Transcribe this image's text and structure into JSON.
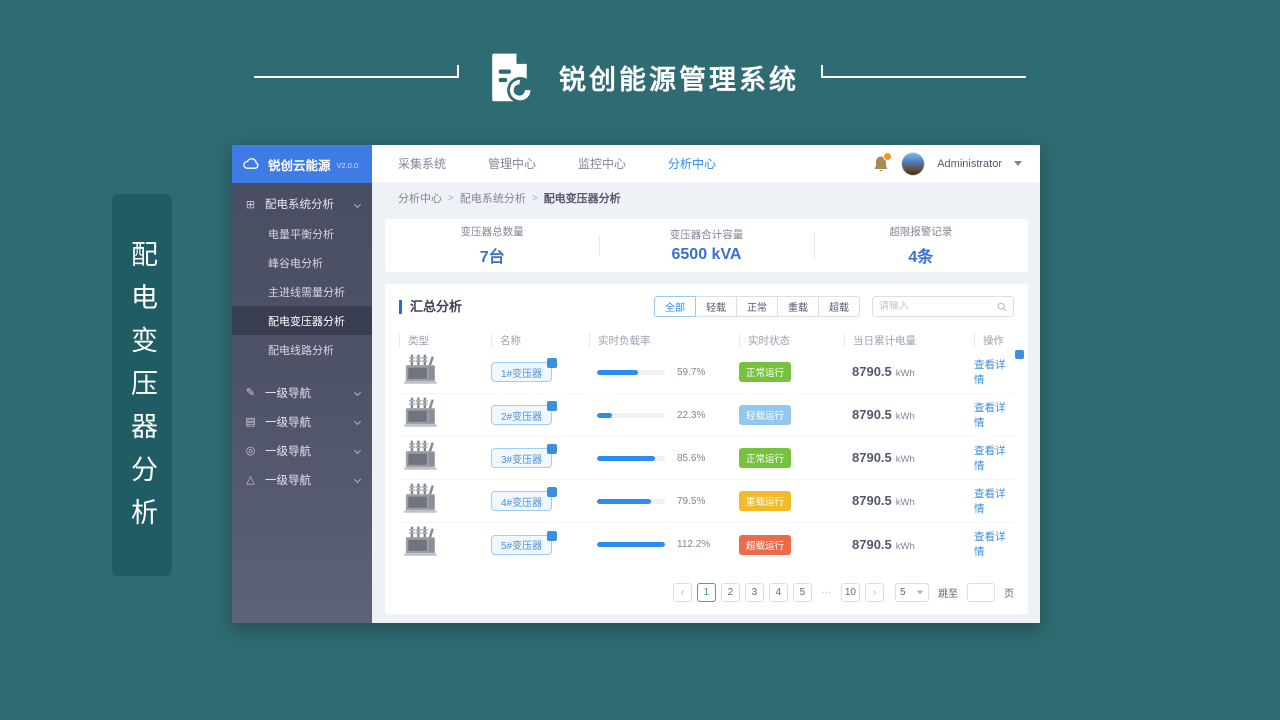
{
  "banner": {
    "title": "锐创能源管理系统"
  },
  "side_label": {
    "text": "配电变压器分析"
  },
  "app": {
    "sidebar": {
      "logo_text": "锐创云能源",
      "logo_version": "V2.0.0",
      "group_label": "配电系统分析",
      "children": [
        {
          "label": "电量平衡分析"
        },
        {
          "label": "峰谷电分析"
        },
        {
          "label": "主进线需量分析"
        },
        {
          "label": "配电变压器分析"
        },
        {
          "label": "配电线路分析"
        }
      ],
      "nav_items": [
        {
          "label": "一级导航",
          "icon": "edit-icon",
          "glyph": "✎"
        },
        {
          "label": "一级导航",
          "icon": "list-icon",
          "glyph": "▤"
        },
        {
          "label": "一级导航",
          "icon": "check-circle-icon",
          "glyph": "◎"
        },
        {
          "label": "一级导航",
          "icon": "warning-triangle-icon",
          "glyph": "△"
        }
      ],
      "group_icon_glyph": "⊞"
    },
    "topnav": {
      "items": [
        {
          "label": "采集系统"
        },
        {
          "label": "管理中心"
        },
        {
          "label": "监控中心"
        },
        {
          "label": "分析中心"
        }
      ],
      "user": {
        "name": "Administrator"
      }
    },
    "breadcrumb": {
      "separator": ">",
      "items": [
        {
          "label": "分析中心"
        },
        {
          "label": "配电系统分析"
        },
        {
          "label": "配电变压器分析"
        }
      ]
    },
    "stats": [
      {
        "label": "变压器总数量",
        "value": "7台"
      },
      {
        "label": "变压器合计容量",
        "value": "6500 kVA"
      },
      {
        "label": "超限报警记录",
        "value": "4条"
      }
    ],
    "summary": {
      "title": "汇总分析",
      "filters": [
        {
          "label": "全部"
        },
        {
          "label": "轻载"
        },
        {
          "label": "正常"
        },
        {
          "label": "重载"
        },
        {
          "label": "超载"
        }
      ],
      "active_filter": "全部",
      "search_placeholder": "请输入",
      "table_headers": [
        {
          "label": "类型"
        },
        {
          "label": "名称"
        },
        {
          "label": "实时负载率"
        },
        {
          "label": "实时状态"
        },
        {
          "label": "当日累计电量"
        },
        {
          "label": "操作"
        }
      ],
      "rows": [
        {
          "name": "1#变压器",
          "load_label": "59.7%",
          "load_value": 59.7,
          "status": "正常运行",
          "status_type": "normal",
          "energy": "8790.5",
          "unit": "kWh",
          "action": "查看详情"
        },
        {
          "name": "2#变压器",
          "load_label": "22.3%",
          "load_value": 22.3,
          "status": "轻载运行",
          "status_type": "light",
          "energy": "8790.5",
          "unit": "kWh",
          "action": "查看详情"
        },
        {
          "name": "3#变压器",
          "load_label": "85.6%",
          "load_value": 85.6,
          "status": "正常运行",
          "status_type": "normal",
          "energy": "8790.5",
          "unit": "kWh",
          "action": "查看详情"
        },
        {
          "name": "4#变压器",
          "load_label": "79.5%",
          "load_value": 79.5,
          "status": "重载运行",
          "status_type": "heavy",
          "energy": "8790.5",
          "unit": "kWh",
          "action": "查看详情"
        },
        {
          "name": "5#变压器",
          "load_label": "112.2%",
          "load_value": 112.2,
          "status": "超载运行",
          "status_type": "over",
          "energy": "8790.5",
          "unit": "kWh",
          "action": "查看详情"
        }
      ],
      "pagination": {
        "prev": "‹",
        "next": "›",
        "pages": [
          {
            "label": "1"
          },
          {
            "label": "2"
          },
          {
            "label": "3"
          },
          {
            "label": "4"
          },
          {
            "label": "5"
          },
          {
            "label": "···"
          },
          {
            "label": "10"
          }
        ],
        "active_page": "1",
        "page_size": "5",
        "jump_label": "跳至",
        "jump_suffix": "页"
      }
    },
    "colors": {
      "accent_blue": "#2d8cf0",
      "value_blue": "#3a6ed5",
      "status_normal": "#76c13e",
      "status_light": "#92c8ef",
      "status_heavy": "#f2bb2a",
      "status_over": "#ec6a4a",
      "sidebar_header": "#3e7be5",
      "page_teal": "#2e6b72"
    }
  }
}
